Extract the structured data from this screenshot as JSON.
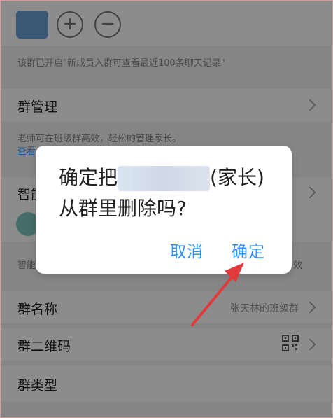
{
  "top_notice": "该群已开启\"新成员入群可查看最近100条聊天记录\"",
  "group_management": {
    "label": "群管理",
    "note": "老师可在班级群高效，轻松的管理家长。",
    "link": "查看"
  },
  "smart": {
    "label": "智能",
    "note_left": "智能",
    "note_right": "效"
  },
  "group_name": {
    "label": "群名称",
    "value": "张天林的班级群"
  },
  "qr_code": {
    "label": "群二维码",
    "icon": "qr-code-icon"
  },
  "group_type": {
    "label": "群类型"
  },
  "dialog": {
    "text_before": "确定把",
    "text_after": "(家长)从群里删除吗?",
    "cancel": "取消",
    "confirm": "确定"
  },
  "colors": {
    "accent": "#2f93ff",
    "arrow": "#e03a3a"
  }
}
